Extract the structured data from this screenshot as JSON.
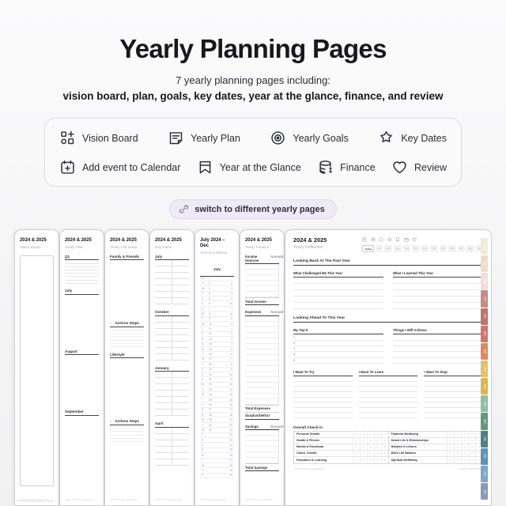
{
  "hero": {
    "title": "Yearly Planning Pages",
    "subtitle_1": "7 yearly planning pages including:",
    "subtitle_2": "vision board, plan, goals, key dates, year at the glance, finance, and review"
  },
  "features": {
    "row1": [
      {
        "icon": "vision-board-icon",
        "label": "Vision Board"
      },
      {
        "icon": "yearly-plan-icon",
        "label": "Yearly Plan"
      },
      {
        "icon": "yearly-goals-icon",
        "label": "Yearly Goals"
      },
      {
        "icon": "key-dates-icon",
        "label": "Key Dates"
      }
    ],
    "row2": [
      {
        "icon": "add-event-icon",
        "label": "Add event to Calendar"
      },
      {
        "icon": "year-at-glance-icon",
        "label": "Year at the Glance"
      },
      {
        "icon": "finance-icon",
        "label": "Finance"
      },
      {
        "icon": "review-icon",
        "label": "Review"
      }
    ]
  },
  "switch_pill": {
    "icon": "link-icon",
    "label": "switch to different yearly pages"
  },
  "thumbnails": [
    {
      "title": "2024 & 2025",
      "subtitle": "Vision Board",
      "kind": "vision"
    },
    {
      "title": "2024 & 2025",
      "subtitle": "Yearly Plan",
      "kind": "plan",
      "blocks": [
        "Q1",
        "July",
        "August",
        "September"
      ]
    },
    {
      "title": "2024 & 2025",
      "subtitle": "Yearly Life Goals",
      "kind": "goals",
      "blocks": [
        "Family & Friends",
        "Actions Steps",
        "Lifestyle",
        "Actions Steps"
      ]
    },
    {
      "title": "2024 & 2025",
      "subtitle": "Key Dates",
      "kind": "keydates",
      "blocks": [
        "July",
        "October",
        "January",
        "April"
      ]
    },
    {
      "title": "July 2024 – Dec",
      "subtitle": "Year At A Glance",
      "kind": "glance",
      "blocks": [
        "July"
      ]
    },
    {
      "title": "2024 & 2025",
      "subtitle": "Yearly Finance",
      "kind": "finance",
      "blocks": [
        "Income Sources",
        "Total Income",
        "Expenses",
        "Total Expenses",
        "Surplus/Deficit",
        "Savings",
        "Total Savings"
      ]
    }
  ],
  "thumb_footer": "IVORY DIGITAL CALENDAR",
  "reflection": {
    "title": "2024 & 2025",
    "subtitle": "Yearly Reflection",
    "tool_icons": [
      "note-icon",
      "target-icon",
      "circle-icon",
      "star-icon",
      "bookmark-icon",
      "calendar-icon",
      "heart-icon"
    ],
    "month_tabs": [
      "Yearly",
      "Jul",
      "Aug",
      "Sep",
      "Oct",
      "Nov",
      "Dec",
      "Jan",
      "Feb",
      "Mar",
      "Apr",
      "May",
      "Jun"
    ],
    "active_tab": "Yearly",
    "section_back": "Looking Back At The Past Year",
    "back_cols": [
      "What Challenged Me This Year",
      "What I Learned This Year"
    ],
    "section_ahead": "Looking Ahead To This Year",
    "ahead_cols": [
      "My Top 5",
      "Things I Will Achieve"
    ],
    "top5_numbers": [
      "1",
      "2",
      "3",
      "4",
      "5"
    ],
    "want_cols": [
      "I Want To Try",
      "I Want To Learn",
      "I Want To Stop"
    ],
    "checkin_title": "Overall Check-in",
    "checkin_scale": [
      "1",
      "2",
      "3",
      "4",
      "5"
    ],
    "checkin_left": [
      "Personal Growth",
      "Health & Fitness",
      "Mental & Emotional",
      "Career Growth",
      "Education & Learning"
    ],
    "checkin_right": [
      "Financial Wellbeing",
      "Social Life & Relationships",
      "Hobbies & Leisure",
      "Work Life Balance",
      "Spiritual Wellbeing"
    ],
    "footer_left": "IVORY DIGITAL CALENDAR",
    "footer_right": "YEARLY REFLECTION"
  },
  "color_tabs": [
    {
      "label": "JUL",
      "color": "#f4ead9"
    },
    {
      "label": "AUG",
      "color": "#efdcc7"
    },
    {
      "label": "SEP",
      "color": "#f3dedc"
    },
    {
      "label": "OCT",
      "color": "#c78a85"
    },
    {
      "label": "NOV",
      "color": "#c0736c"
    },
    {
      "label": "DEC",
      "color": "#d9736a"
    },
    {
      "label": "JAN",
      "color": "#e08a5c"
    },
    {
      "label": "FEB",
      "color": "#e7c066"
    },
    {
      "label": "MAR",
      "color": "#e0b44f"
    },
    {
      "label": "APR",
      "color": "#8cc2a0"
    },
    {
      "label": "MAY",
      "color": "#5f9c7d"
    },
    {
      "label": "JUN",
      "color": "#4e7f81"
    },
    {
      "label": "JUL",
      "color": "#5c93b8"
    },
    {
      "label": "AUG",
      "color": "#7fa6cc"
    },
    {
      "label": "SEP",
      "color": "#8a9ab5"
    }
  ],
  "footer_brand": "© IVORYDIGITAL.HUB"
}
